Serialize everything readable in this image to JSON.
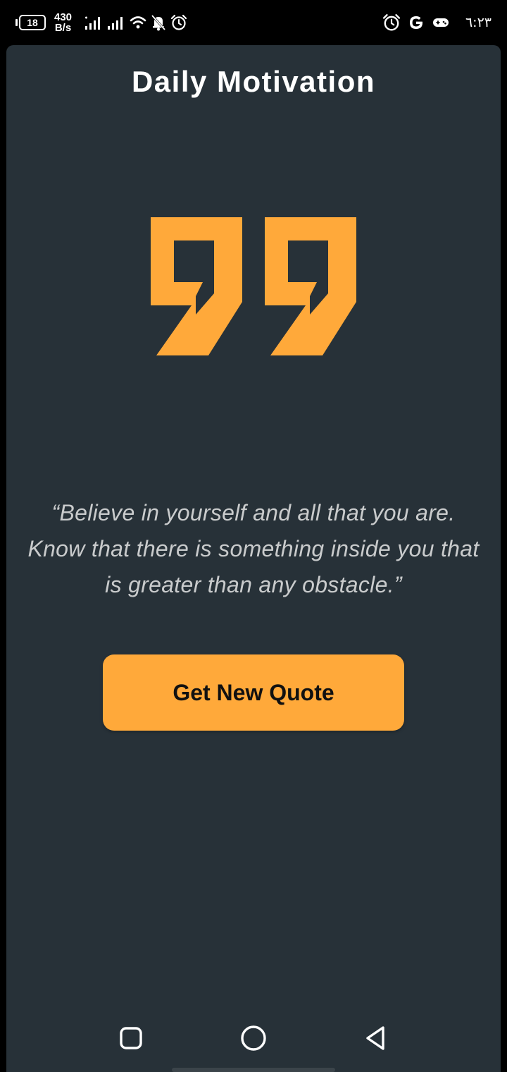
{
  "status_bar": {
    "battery_level": "18",
    "net_speed_value": "430",
    "net_speed_unit": "B/s",
    "time": "٦:٢٣",
    "left_icons": [
      "signal-icon",
      "signal-icon",
      "wifi-icon",
      "mute-notifications-icon",
      "alarm-icon"
    ],
    "right_icons": [
      "alarm-icon",
      "google-icon",
      "game-controller-icon"
    ]
  },
  "app": {
    "title": "Daily Motivation",
    "quote": "“Believe in yourself and all that you are. Know that there is something inside you that is greater than any obstacle.”",
    "button_label": "Get New Quote",
    "quote_icon": "quote-mark-icon"
  },
  "nav": {
    "icons": [
      "recents-square-icon",
      "home-circle-icon",
      "back-triangle-icon"
    ]
  },
  "colors": {
    "background": "#273138",
    "accent": "#ffa93a",
    "quote_text": "#c9cbcc",
    "title_text": "#ffffff"
  }
}
